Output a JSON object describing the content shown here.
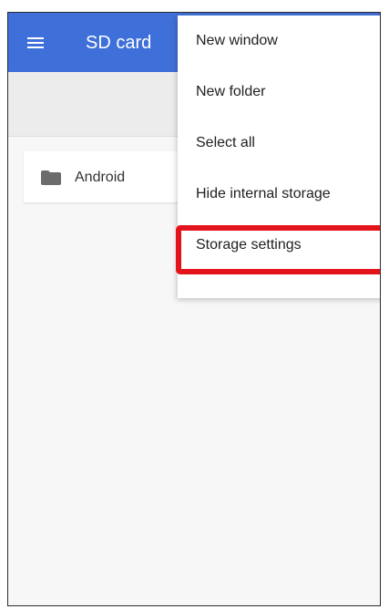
{
  "app_bar": {
    "title": "SD card",
    "menu_icon": "hamburger-menu-icon",
    "color": "#3f6fd8"
  },
  "files": [
    {
      "name": "Android",
      "icon": "folder-icon"
    }
  ],
  "overflow_menu": {
    "items": [
      {
        "label": "New window"
      },
      {
        "label": "New folder"
      },
      {
        "label": "Select all"
      },
      {
        "label": "Hide internal storage"
      },
      {
        "label": "Storage settings",
        "highlighted": true
      }
    ]
  },
  "highlight_color": "#e3131b"
}
